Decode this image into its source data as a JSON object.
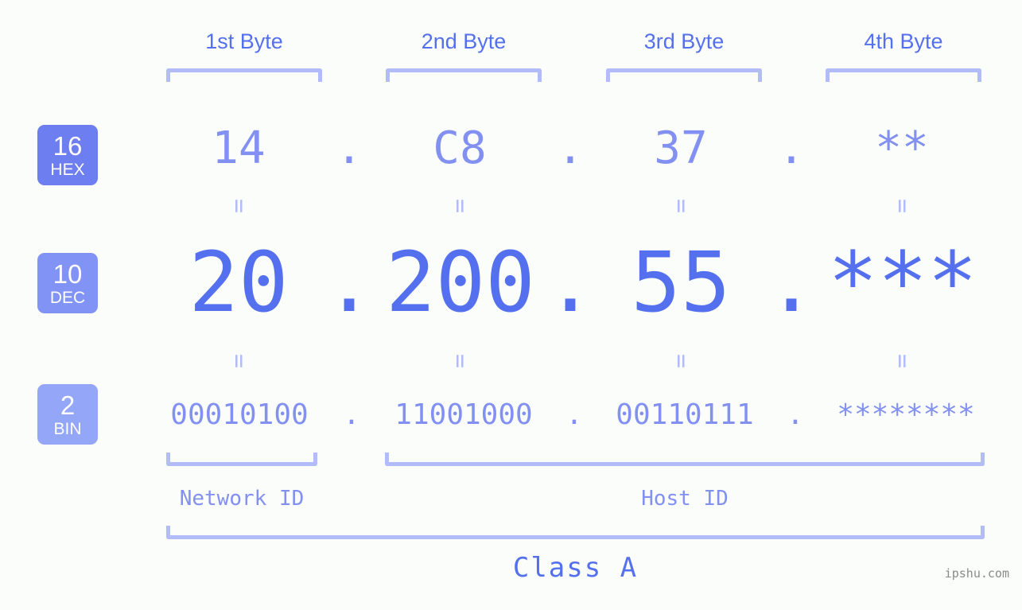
{
  "page": {
    "background_color": "#fbfdfa",
    "accent_strong": "#5470ee",
    "accent_mid": "#8290f2",
    "accent_light": "#b2bcf9",
    "watermark": "ipshu.com"
  },
  "byte_headers": [
    {
      "label": "1st Byte"
    },
    {
      "label": "2nd Byte"
    },
    {
      "label": "3rd Byte"
    },
    {
      "label": "4th Byte"
    }
  ],
  "bases": [
    {
      "number": "16",
      "name": "HEX",
      "color": "#6c7ef0"
    },
    {
      "number": "10",
      "name": "DEC",
      "color": "#8193f4"
    },
    {
      "number": "2",
      "name": "BIN",
      "color": "#93a6f7"
    }
  ],
  "rows": {
    "hex": {
      "base_label": "HEX",
      "values": [
        "14",
        "C8",
        "37",
        "**"
      ],
      "separators": [
        ".",
        ".",
        "."
      ]
    },
    "dec": {
      "base_label": "DEC",
      "values": [
        "20",
        "200",
        "55",
        "***"
      ],
      "separators": [
        ".",
        ".",
        "."
      ]
    },
    "bin": {
      "base_label": "BIN",
      "values": [
        "00010100",
        "11001000",
        "00110111",
        "********"
      ],
      "separators": [
        ".",
        ".",
        "."
      ]
    }
  },
  "equals": {
    "symbol": "=",
    "count_per_row": 4
  },
  "sections": [
    {
      "label": "Network ID"
    },
    {
      "label": "Host ID"
    }
  ],
  "class": {
    "label": "Class A"
  }
}
